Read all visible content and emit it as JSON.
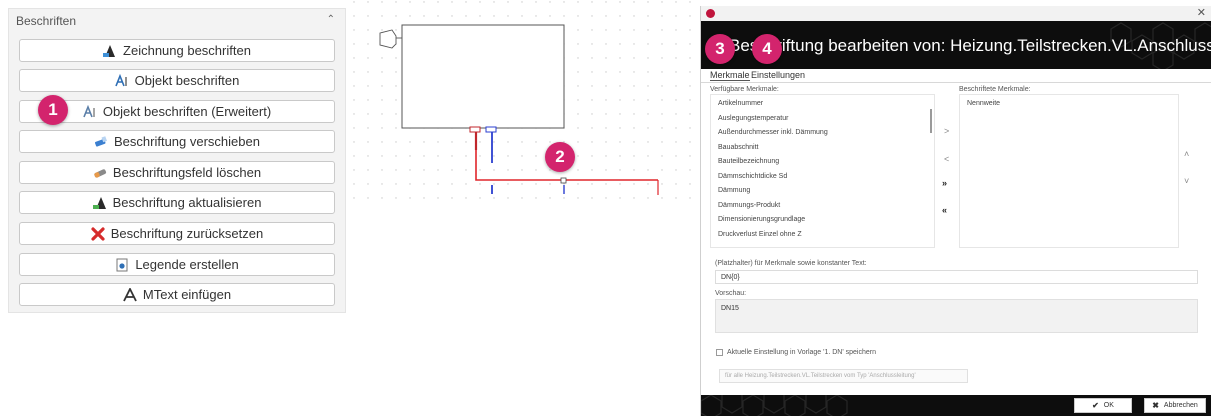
{
  "panel": {
    "title": "Beschriften",
    "collapse_icon": "chevron-up-icon",
    "buttons": [
      {
        "label": "Zeichnung beschriften",
        "icon": "annotate-drawing-icon"
      },
      {
        "label": "Objekt beschriften",
        "icon": "annotate-object-icon"
      },
      {
        "label": "Objekt beschriften (Erweitert)",
        "icon": "annotate-object-extended-icon"
      },
      {
        "label": "Beschriftung verschieben",
        "icon": "move-label-icon"
      },
      {
        "label": "Beschriftungsfeld löschen",
        "icon": "eraser-icon"
      },
      {
        "label": "Beschriftung aktualisieren",
        "icon": "refresh-label-icon"
      },
      {
        "label": "Beschriftung zurücksetzen",
        "icon": "red-x-icon"
      },
      {
        "label": "Legende erstellen",
        "icon": "legend-icon"
      },
      {
        "label": "MText einfügen",
        "icon": "mtext-icon"
      }
    ]
  },
  "badges": [
    "1",
    "2",
    "3",
    "4"
  ],
  "dialog": {
    "title": "Beschriftung bearbeiten von: Heizung.Teilstrecken.VL.Anschlussleitung",
    "tabs": [
      "Merkmale",
      "Einstellungen"
    ],
    "available_label": "Verfügbare Merkmale:",
    "available_items": [
      "Artikelnummer",
      "Auslegungstemperatur",
      "Außendurchmesser inkl. Dämmung",
      "Bauabschnitt",
      "Bauteilbezeichnung",
      "Dämmschichtdicke Sd",
      "Dämmung",
      "Dämmungs-Produkt",
      "Dimensionierungsgrundlage",
      "Druckverlust Einzel ohne Z"
    ],
    "labeled_label": "Beschriftete Merkmale:",
    "labeled_items": [
      "Nennweite"
    ],
    "transfer_buttons": [
      ">",
      "<",
      "»",
      "«"
    ],
    "order_buttons": [
      "˄",
      "˅"
    ],
    "placeholder_label": "(Platzhalter) für Merkmale sowie konstanter Text:",
    "placeholder_value": "DN{0}",
    "preview_label": "Vorschau:",
    "preview_value": "DN15",
    "save_checkbox_label": "Aktuelle Einstellung in Vorlage '1. DN' speichern",
    "scope_select": "für alle Heizung.Teilstrecken.VL.Teilstrecken vom Typ 'Anschlussleitung'",
    "ok_label": "OK",
    "cancel_label": "Abbrechen"
  },
  "colors": {
    "badge": "#d3246d",
    "supply_line": "#e0262b",
    "return_line": "#2b3fd0",
    "banner": "#0d0d0d"
  }
}
